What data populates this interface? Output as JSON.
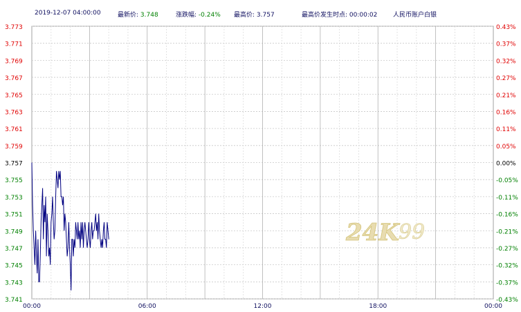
{
  "header": {
    "datetime": "2019-12-07 04:00:00",
    "latest_label": "最新价:",
    "latest_value": "3.748",
    "change_label": "涨跌幅:",
    "change_value": "-0.24%",
    "high_label": "最高价:",
    "high_value": "3.757",
    "high_time_label": "最高价发生时点:",
    "high_time_value": "00:00:02",
    "product_name": "人民币账户白银"
  },
  "watermark": {
    "text_main": "24K",
    "text_sub": "99"
  },
  "colors": {
    "line": "#000080",
    "grid": "#c8c8c8",
    "up_label": "#e00000",
    "down_label": "#008000",
    "neutral_label": "#000000",
    "time_label": "#101060"
  },
  "chart_data": {
    "type": "line",
    "title": "",
    "xlabel": "",
    "ylabel": "",
    "x_ticks": [
      "00:00",
      "06:00",
      "12:00",
      "18:00",
      "00:00"
    ],
    "x_range_hours": [
      0,
      24
    ],
    "ylim": [
      3.741,
      3.773
    ],
    "y_ticks_left": [
      "3.773",
      "3.771",
      "3.769",
      "3.767",
      "3.765",
      "3.763",
      "3.761",
      "3.759",
      "3.757",
      "3.755",
      "3.753",
      "3.751",
      "3.749",
      "3.747",
      "3.745",
      "3.743",
      "3.741"
    ],
    "y_ticks_right": [
      "0.43%",
      "0.37%",
      "0.32%",
      "0.27%",
      "0.21%",
      "0.16%",
      "0.11%",
      "0.05%",
      "0.00%",
      "-0.05%",
      "-0.11%",
      "-0.16%",
      "-0.21%",
      "-0.27%",
      "-0.32%",
      "-0.37%",
      "-0.43%"
    ],
    "reference_price": 3.757,
    "grid": true,
    "series": [
      {
        "x": [
          0.0,
          0.04,
          0.08,
          0.12,
          0.16,
          0.2,
          0.24,
          0.28,
          0.32,
          0.36,
          0.4,
          0.44,
          0.48,
          0.52,
          0.56,
          0.6,
          0.64,
          0.68,
          0.72,
          0.76,
          0.8,
          0.84,
          0.88,
          0.92,
          0.96,
          1.0,
          1.04,
          1.08,
          1.12,
          1.16,
          1.2,
          1.24,
          1.28,
          1.32,
          1.36,
          1.4,
          1.44,
          1.48,
          1.52,
          1.56,
          1.6,
          1.64,
          1.68,
          1.72,
          1.76,
          1.8,
          1.84,
          1.88,
          1.92,
          1.96,
          2.0,
          2.04,
          2.08,
          2.12,
          2.16,
          2.2,
          2.24,
          2.28,
          2.32,
          2.36,
          2.4,
          2.44,
          2.48,
          2.52,
          2.56,
          2.6,
          2.64,
          2.68,
          2.72,
          2.76,
          2.8,
          2.84,
          2.88,
          2.92,
          2.96,
          3.0,
          3.04,
          3.08,
          3.12,
          3.16,
          3.2,
          3.24,
          3.28,
          3.32,
          3.36,
          3.4,
          3.44,
          3.48,
          3.52,
          3.56,
          3.6,
          3.64,
          3.68,
          3.72,
          3.76,
          3.8,
          3.84,
          3.88,
          3.92,
          3.96,
          4.0
        ],
        "y": [
          3.757,
          3.752,
          3.749,
          3.747,
          3.745,
          3.749,
          3.746,
          3.744,
          3.748,
          3.743,
          3.743,
          3.746,
          3.75,
          3.752,
          3.754,
          3.748,
          3.752,
          3.75,
          3.753,
          3.746,
          3.751,
          3.749,
          3.746,
          3.747,
          3.745,
          3.75,
          3.751,
          3.753,
          3.75,
          3.748,
          3.749,
          3.753,
          3.756,
          3.755,
          3.754,
          3.756,
          3.755,
          3.756,
          3.753,
          3.753,
          3.752,
          3.753,
          3.749,
          3.751,
          3.75,
          3.748,
          3.746,
          3.747,
          3.75,
          3.747,
          3.745,
          3.742,
          3.748,
          3.748,
          3.746,
          3.748,
          3.747,
          3.75,
          3.749,
          3.748,
          3.75,
          3.748,
          3.749,
          3.747,
          3.75,
          3.748,
          3.75,
          3.747,
          3.749,
          3.75,
          3.749,
          3.748,
          3.747,
          3.748,
          3.75,
          3.748,
          3.747,
          3.749,
          3.75,
          3.748,
          3.749,
          3.749,
          3.75,
          3.751,
          3.749,
          3.75,
          3.748,
          3.751,
          3.749,
          3.748,
          3.747,
          3.748,
          3.747,
          3.749,
          3.75,
          3.748,
          3.748,
          3.747,
          3.75,
          3.749,
          3.748
        ]
      }
    ]
  }
}
